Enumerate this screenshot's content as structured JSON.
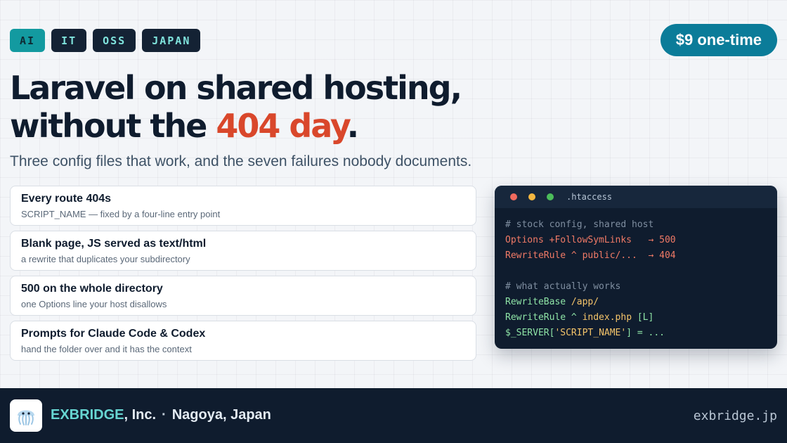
{
  "tags": [
    {
      "label": "AI"
    },
    {
      "label": "IT"
    },
    {
      "label": "OSS"
    },
    {
      "label": "JAPAN"
    }
  ],
  "price": "$9 one-time",
  "headline": {
    "line1": "Laravel on shared hosting,",
    "line2_pre": "without the ",
    "line2_highlight": "404 day",
    "line2_post": "."
  },
  "subtitle": "Three config files that work, and the seven failures nobody documents.",
  "cards": [
    {
      "title": "Every route 404s",
      "sub": "SCRIPT_NAME — fixed by a four-line entry point"
    },
    {
      "title": "Blank page, JS served as text/html",
      "sub": "a rewrite that duplicates your subdirectory"
    },
    {
      "title": "500 on the whole directory",
      "sub": "one Options line your host disallows"
    },
    {
      "title": "Prompts for Claude Code & Codex",
      "sub": "hand the folder over and it has the context"
    }
  ],
  "code": {
    "filename": ".htaccess",
    "comment1": "# stock config, shared host",
    "bad1": "Options +FollowSymLinks   → 500",
    "bad2": "RewriteRule ^ public/...  → 404",
    "comment2": "# what actually works",
    "good1_kw": "RewriteBase ",
    "good1_val": "/app/",
    "good2_kw": "RewriteRule ^ ",
    "good2_val": "index.php",
    "good2_tail": " [L]",
    "good3_kw": "$_SERVER[",
    "good3_val": "'SCRIPT_NAME'",
    "good3_tail": "] = ..."
  },
  "footer": {
    "brand_name": "EXBRIDGE",
    "brand_suffix": ", Inc.",
    "separator": "·",
    "location": "Nagoya, Japan",
    "site": "exbridge.jp",
    "logo_icon": "jellyfish-icon"
  },
  "colors": {
    "accent": "#0b7c99",
    "highlight": "#d9472b",
    "dark": "#0f1c2e",
    "teal": "#67d6d2"
  }
}
